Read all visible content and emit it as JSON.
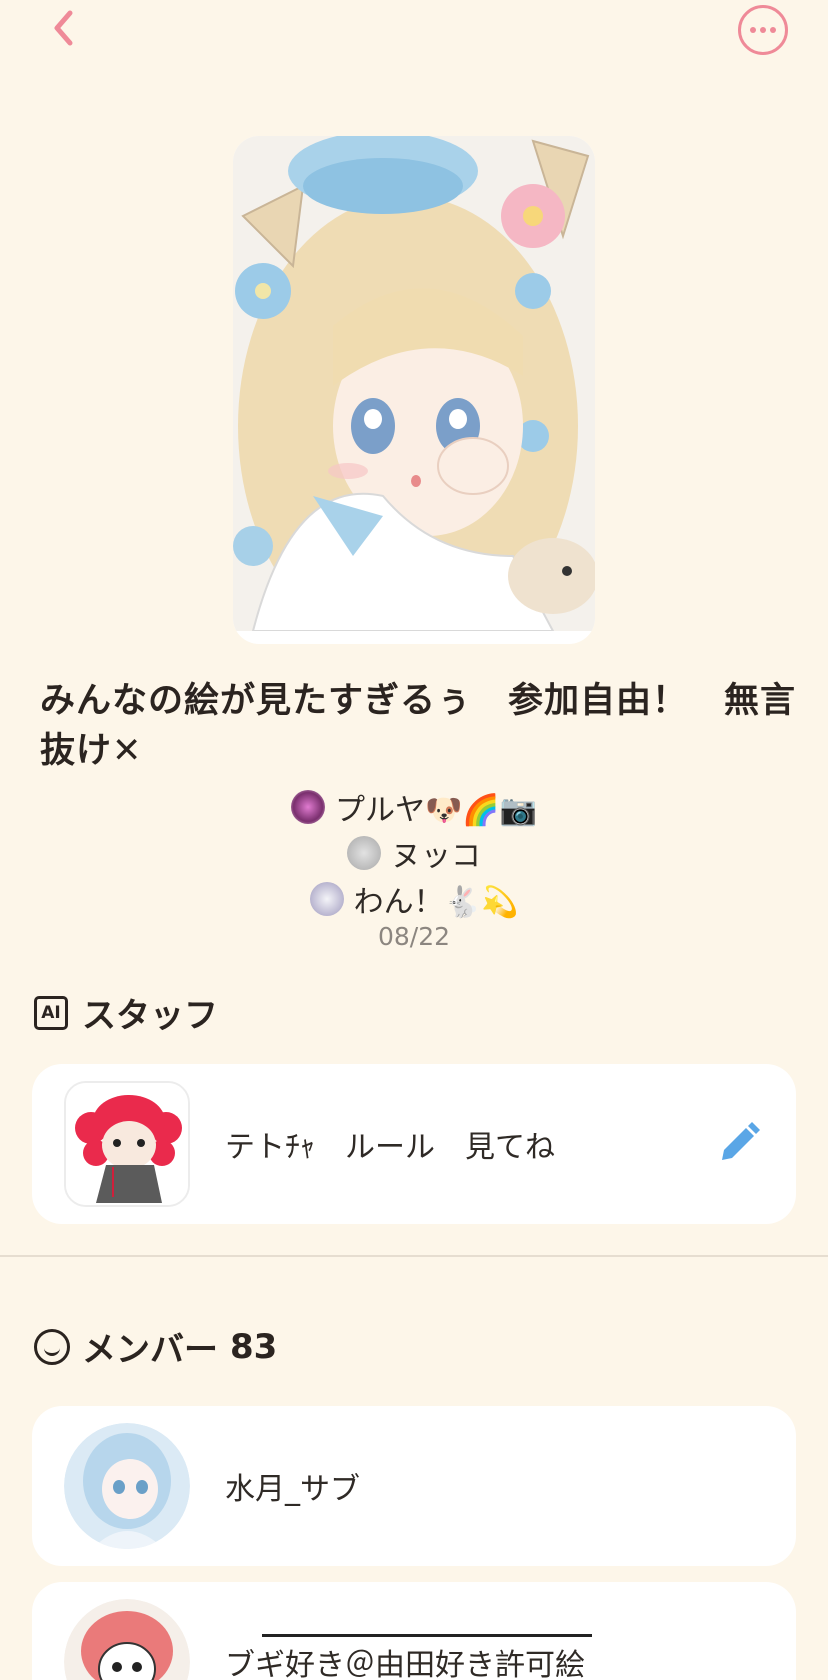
{
  "header": {
    "back_icon": "chevron-left-icon",
    "more_icon": "ellipsis-circle-icon",
    "accent_color": "#ef8a98"
  },
  "group": {
    "title": "みんなの絵が見たすぎるぅ　参加自由！　無言抜け✕",
    "admins": [
      "プルヤ🐶🌈📷",
      "ヌッコ",
      "わん！🐇💫"
    ],
    "created_date": "08/22"
  },
  "staff": {
    "heading": "スタッフ",
    "badge": "AI",
    "members": [
      {
        "name": "テトﾁｬ　ルール　見てね",
        "edit_icon": "pencil-icon"
      }
    ]
  },
  "members": {
    "heading": "メンバー",
    "count": "83",
    "items": [
      {
        "name": "水月_サブ"
      },
      {
        "name": "ブギ好き＠由田好き許可絵"
      }
    ]
  },
  "colors": {
    "background": "#fdf6e9",
    "edit_icon": "#5aa6e6"
  }
}
